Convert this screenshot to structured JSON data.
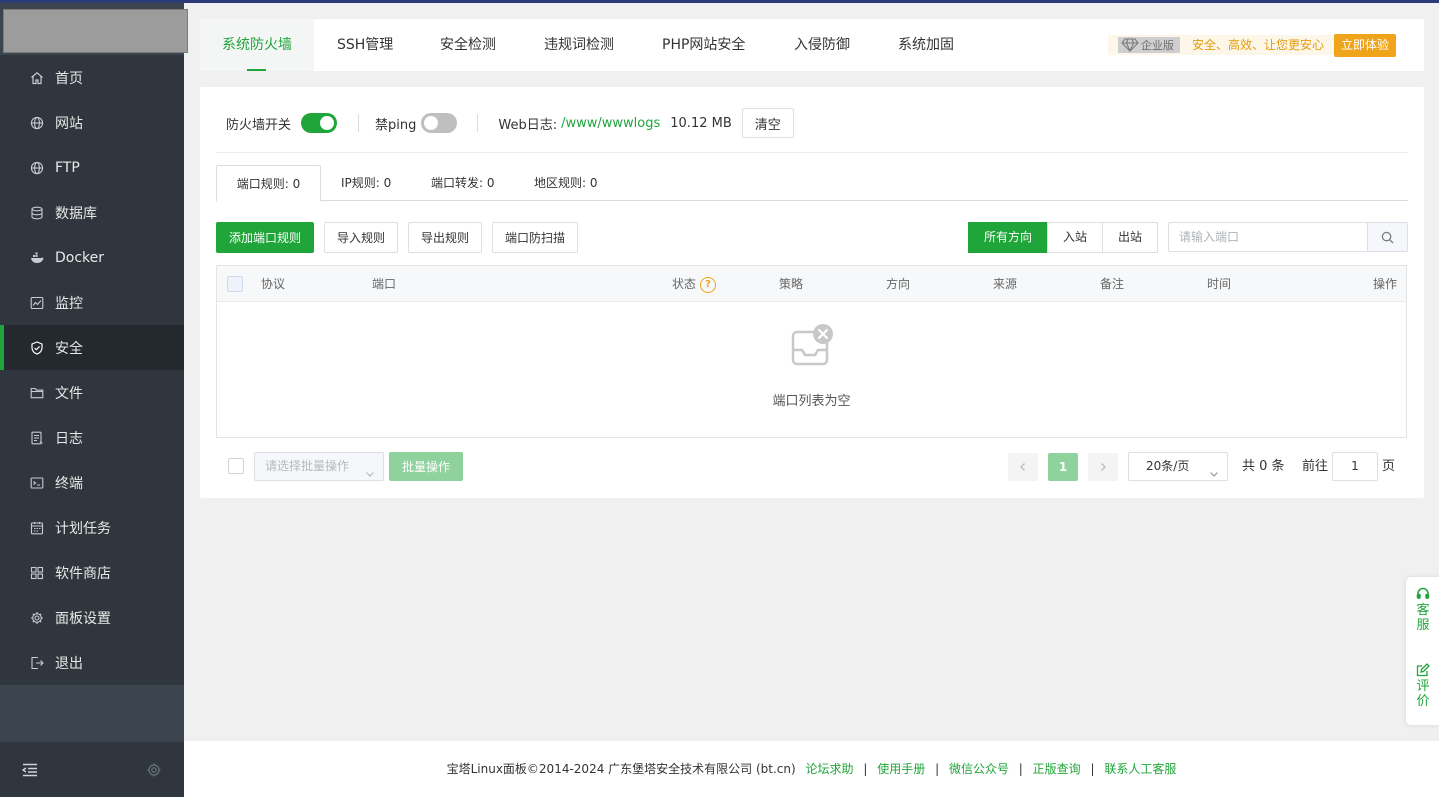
{
  "sidebar": {
    "items": [
      {
        "label": "首页",
        "icon": "home-icon"
      },
      {
        "label": "网站",
        "icon": "globe-icon"
      },
      {
        "label": "FTP",
        "icon": "ftp-globe-icon"
      },
      {
        "label": "数据库",
        "icon": "database-icon"
      },
      {
        "label": "Docker",
        "icon": "docker-icon"
      },
      {
        "label": "监控",
        "icon": "monitor-icon"
      },
      {
        "label": "安全",
        "icon": "shield-icon",
        "active": true
      },
      {
        "label": "文件",
        "icon": "folder-icon"
      },
      {
        "label": "日志",
        "icon": "log-icon"
      },
      {
        "label": "终端",
        "icon": "terminal-icon"
      },
      {
        "label": "计划任务",
        "icon": "calendar-icon"
      },
      {
        "label": "软件商店",
        "icon": "app-store-icon"
      },
      {
        "label": "面板设置",
        "icon": "settings-icon"
      },
      {
        "label": "退出",
        "icon": "logout-icon"
      }
    ]
  },
  "tabs": [
    {
      "label": "系统防火墙",
      "active": true
    },
    {
      "label": "SSH管理"
    },
    {
      "label": "安全检测"
    },
    {
      "label": "违规词检测"
    },
    {
      "label": "PHP网站安全"
    },
    {
      "label": "入侵防御"
    },
    {
      "label": "系统加固"
    }
  ],
  "promo": {
    "badge": "企业版",
    "text": "安全、高效、让您更安心",
    "button": "立即体验"
  },
  "firewall": {
    "switch_label": "防火墙开关",
    "switch_on": true,
    "ping_label": "禁ping",
    "ping_on": false,
    "weblog_label": "Web日志:",
    "weblog_path": "/www/wwwlogs",
    "weblog_size": "10.12 MB",
    "clear_button": "清空"
  },
  "subtabs": [
    {
      "label": "端口规则:  0",
      "active": true
    },
    {
      "label": "IP规则:  0"
    },
    {
      "label": "端口转发:  0"
    },
    {
      "label": "地区规则:  0"
    }
  ],
  "toolbar": {
    "add_button": "添加端口规则",
    "import_button": "导入规则",
    "export_button": "导出规则",
    "scan_button": "端口防扫描",
    "directions": [
      "所有方向",
      "入站",
      "出站"
    ],
    "search_placeholder": "请输入端口"
  },
  "table": {
    "columns": [
      "协议",
      "端口",
      "状态",
      "策略",
      "方向",
      "来源",
      "备注",
      "时间",
      "操作"
    ],
    "status_help": "?",
    "rows": [],
    "empty_text": "端口列表为空"
  },
  "footbar": {
    "batch_placeholder": "请选择批量操作",
    "batch_button": "批量操作",
    "current_page": "1",
    "page_size": "20条/页",
    "total": "共 0 条",
    "goto_label": "前往",
    "goto_value": "1",
    "page_unit": "页"
  },
  "footer": {
    "copyright": "宝塔Linux面板©2014-2024 广东堡塔安全技术有限公司 (bt.cn)",
    "links": [
      "论坛求助",
      "使用手册",
      "微信公众号",
      "正版查询",
      "联系人工客服"
    ]
  },
  "floating": {
    "service": "客服",
    "review": "评价"
  },
  "colors": {
    "accent": "#20a53a",
    "sidebar": "#2f363d",
    "promo": "#f0a41c"
  }
}
